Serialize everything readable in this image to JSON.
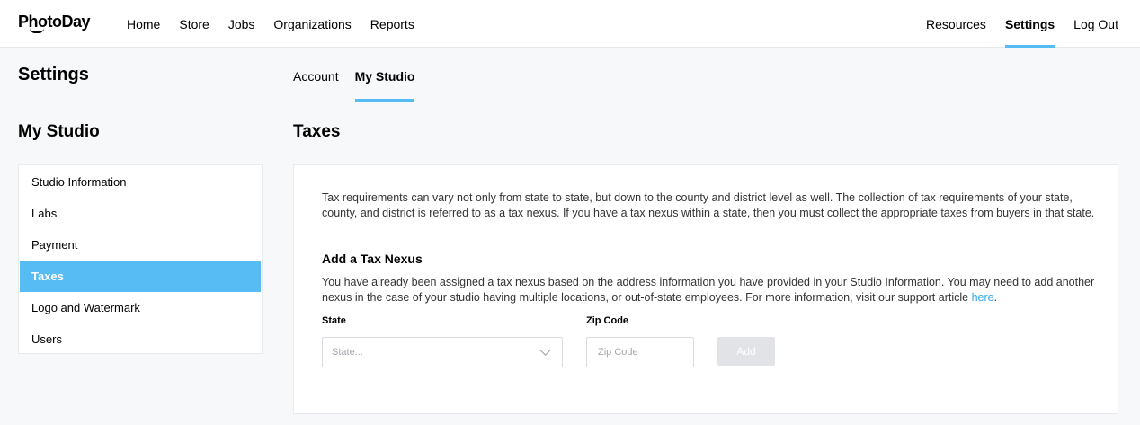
{
  "brand": {
    "logo_text": "PhotoDay"
  },
  "nav": {
    "left": [
      "Home",
      "Store",
      "Jobs",
      "Organizations",
      "Reports"
    ],
    "right": [
      "Resources",
      "Settings",
      "Log Out"
    ],
    "active": "Settings"
  },
  "page": {
    "title": "Settings"
  },
  "tabs": [
    {
      "label": "Account",
      "active": false
    },
    {
      "label": "My Studio",
      "active": true
    }
  ],
  "sidebar": {
    "title": "My Studio",
    "items": [
      {
        "label": "Studio Information",
        "active": false
      },
      {
        "label": "Labs",
        "active": false
      },
      {
        "label": "Payment",
        "active": false
      },
      {
        "label": "Taxes",
        "active": true
      },
      {
        "label": "Logo and Watermark",
        "active": false
      },
      {
        "label": "Users",
        "active": false
      }
    ]
  },
  "main": {
    "title": "Taxes",
    "intro": "Tax requirements can vary not only from state to state, but down to the county and district level as well. The collection of tax requirements of your state, county, and district is referred to as a tax nexus. If you have a tax nexus within a state, then you must collect the appropriate taxes from buyers in that state.",
    "add_title": "Add a Tax Nexus",
    "add_desc": "You have already been assigned a tax nexus based on the address information you have provided in your Studio Information. You may need to add another nexus in the case of your studio having multiple locations, or out-of-state employees. For more information, visit our support article ",
    "link_text": "here",
    "desc_end": ".",
    "form": {
      "state_label": "State",
      "state_placeholder": "State...",
      "zip_label": "Zip Code",
      "zip_placeholder": "Zip Code",
      "add_label": "Add"
    }
  },
  "colors": {
    "accent": "#57bcf4",
    "link": "#2fa8ea",
    "disabled_button": "#e1e3e6"
  }
}
